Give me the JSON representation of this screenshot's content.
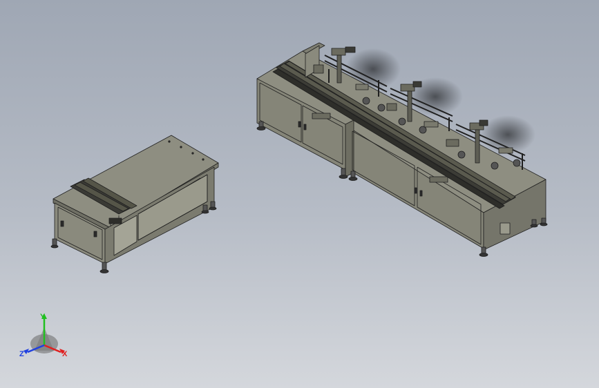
{
  "viewport": {
    "background_top": "#9fa7b4",
    "background_bottom": "#d4d7dc"
  },
  "model": {
    "frame_color": "#7d7d70",
    "panel_color": "#8b8b7e",
    "panel_dark": "#6e6e62",
    "edge_color": "#1f1f1f"
  },
  "triad": {
    "x_label": "X",
    "y_label": "Y",
    "z_label": "Z",
    "x_color": "#e02020",
    "y_color": "#20c020",
    "z_color": "#2040e0"
  }
}
